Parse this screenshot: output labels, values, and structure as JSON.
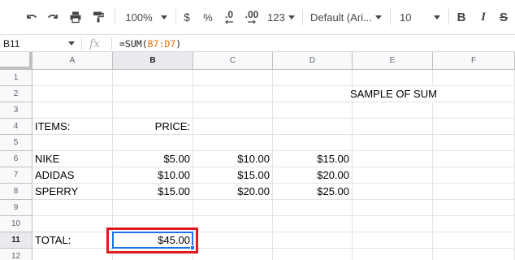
{
  "toolbar": {
    "zoom": "100%",
    "currency": "$",
    "percent": "%",
    "decrease_decimal": ".0",
    "increase_decimal": ".00",
    "more_formats": "123",
    "font": "Default (Ari...",
    "font_size": "10",
    "bold": "B",
    "italic": "I",
    "strikethrough": "S"
  },
  "formula_bar": {
    "name_box": "B11",
    "fx": "fx",
    "formula_prefix": "=SUM(",
    "formula_ref": "B7:D7",
    "formula_suffix": ")"
  },
  "columns": [
    "A",
    "B",
    "C",
    "D",
    "E",
    "F"
  ],
  "rows": [
    "1",
    "2",
    "3",
    "4",
    "5",
    "6",
    "7",
    "8",
    "9",
    "10",
    "11",
    "12"
  ],
  "cells": {
    "E2": "SAMPLE OF SUM",
    "A4": "ITEMS:",
    "B4": "PRICE:",
    "A6": "NIKE",
    "B6": "$5.00",
    "C6": "$10.00",
    "D6": "$15.00",
    "A7": "ADIDAS",
    "B7": "$10.00",
    "C7": "$15.00",
    "D7": "$20.00",
    "A8": "SPERRY",
    "B8": "$15.00",
    "C8": "$20.00",
    "D8": "$25.00",
    "A11": "TOTAL:",
    "B11": "$45.00"
  },
  "selected_cell": "B11",
  "colors": {
    "selection": "#1a73e8",
    "highlight_box": "#e0191f",
    "formula_ref": "#e8710a"
  }
}
